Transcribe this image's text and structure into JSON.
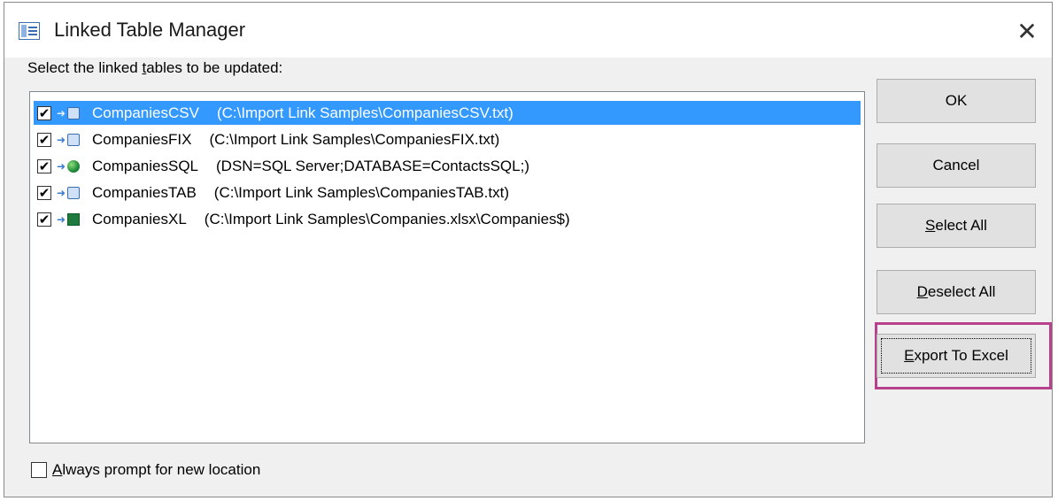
{
  "window": {
    "title": "Linked Table Manager",
    "close_glyph": "✕",
    "icon": "linked-table-manager-icon"
  },
  "instruction": {
    "before": "Select the linked ",
    "accel": "t",
    "after": "ables to be updated:"
  },
  "tables": [
    {
      "name": "CompaniesCSV",
      "path": "(C:\\Import Link Samples\\CompaniesCSV.txt)",
      "checked": true,
      "selected": true,
      "icon": "text-file-icon"
    },
    {
      "name": "CompaniesFIX",
      "path": "(C:\\Import Link Samples\\CompaniesFIX.txt)",
      "checked": true,
      "selected": false,
      "icon": "text-file-icon"
    },
    {
      "name": "CompaniesSQL",
      "path": "(DSN=SQL Server;DATABASE=ContactsSQL;)",
      "checked": true,
      "selected": false,
      "icon": "odbc-globe-icon"
    },
    {
      "name": "CompaniesTAB",
      "path": "(C:\\Import Link Samples\\CompaniesTAB.txt)",
      "checked": true,
      "selected": false,
      "icon": "text-file-icon"
    },
    {
      "name": "CompaniesXL",
      "path": "(C:\\Import Link Samples\\Companies.xlsx\\Companies$)",
      "checked": true,
      "selected": false,
      "icon": "excel-icon"
    }
  ],
  "buttons": {
    "ok": "OK",
    "cancel": "Cancel",
    "select_all": {
      "accel": "S",
      "rest": "elect All"
    },
    "deselect_all": {
      "accel": "D",
      "rest": "eselect All"
    },
    "export_to_excel": {
      "accel": "E",
      "rest": "xport To Excel"
    }
  },
  "always_prompt": {
    "accel": "A",
    "rest": "lways prompt for new location",
    "checked": false
  },
  "colors": {
    "selection": "#3399ff",
    "highlight_border": "#b8418c"
  }
}
